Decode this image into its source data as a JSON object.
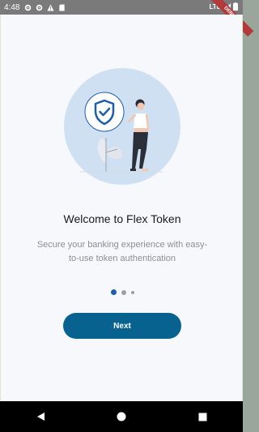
{
  "status_bar": {
    "time": "4:48",
    "network": "LTE",
    "icons": [
      "settings-icon",
      "settings-icon",
      "warning-icon",
      "sd-card-icon",
      "signal-icon",
      "battery-icon"
    ]
  },
  "debug_banner": "DEBUG",
  "onboarding": {
    "title": "Welcome to Flex Token",
    "subtitle": "Secure your banking experience with easy-to-use token authentication",
    "page_index": 0,
    "page_count": 3,
    "next_label": "Next"
  },
  "colors": {
    "primary": "#08628f",
    "active_dot": "#1e5ea8",
    "background": "#f6f8fb",
    "status_bar": "#7a7a7a"
  },
  "nav_bar": {
    "icons": [
      "back-icon",
      "home-icon",
      "recents-icon"
    ]
  }
}
